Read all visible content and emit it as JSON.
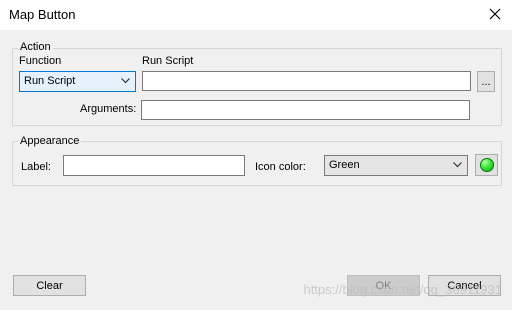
{
  "window": {
    "title": "Map Button"
  },
  "action": {
    "legend": "Action",
    "function_label": "Function",
    "function_value": "Run Script",
    "script_label": "Run Script",
    "script_value": "",
    "browse_label": "...",
    "arguments_label": "Arguments:",
    "arguments_value": ""
  },
  "appearance": {
    "legend": "Appearance",
    "label_label": "Label:",
    "label_value": "",
    "icon_color_label": "Icon color:",
    "icon_color_value": "Green",
    "swatch_color": "#22cc22"
  },
  "footer": {
    "clear_label": "Clear",
    "ok_label": "OK",
    "cancel_label": "Cancel",
    "ok_disabled": true
  },
  "watermark": "https://blog.csdn.net/qq_36911931"
}
